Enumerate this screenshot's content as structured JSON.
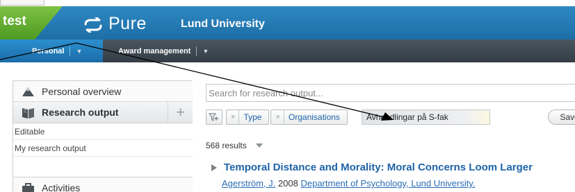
{
  "header": {
    "env_label": "test",
    "logo_text": "Pure",
    "org_name": "Lund University"
  },
  "nav": {
    "personal_label": "Personal",
    "award_label": "Award management",
    "caret": "▼"
  },
  "sidebar": {
    "overview_label": "Personal overview",
    "research_output_label": "Research output",
    "plus_symbol": "+",
    "editable_label": "Editable",
    "my_research_output_label": "My research output",
    "activities_label": "Activities"
  },
  "search": {
    "placeholder": "Search for research output..."
  },
  "filters": {
    "chip_close": "×",
    "type_label": "Type",
    "organisations_label": "Organisations",
    "saved_filter_value": "Avhandlingar på S-fak",
    "save_label": "Save"
  },
  "results": {
    "count_label": "568 results",
    "items": [
      {
        "title": "Temporal Distance and Morality: Moral Concerns Loom Larger",
        "author": "Agerström, J.",
        "year": "2008",
        "department": "Department of Psychology, Lund University."
      }
    ]
  },
  "icons": {
    "logo": "pure-logo-icon",
    "overview": "mountain-icon",
    "research_output": "book-icon",
    "activities": "briefcase-icon",
    "filter": "filter-add-icon",
    "expand": "triangle-right-icon",
    "results_menu": "chevron-down-icon"
  },
  "colors": {
    "header_blue": "#2479b4",
    "env_green": "#6ab236",
    "navbar_dark": "#3e4850",
    "nav_active": "#2480c0",
    "link_blue": "#1e63a8"
  }
}
